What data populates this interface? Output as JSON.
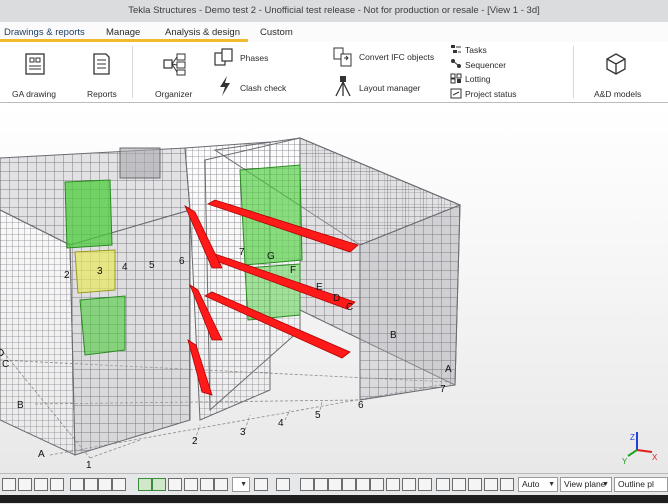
{
  "window": {
    "title": "Tekla Structures - Demo test 2  - Unofficial test release - Not for production or resale - [View 1 - 3d]"
  },
  "tabs": [
    {
      "label": "Drawings & reports",
      "active": true
    },
    {
      "label": "Manage",
      "active": false
    },
    {
      "label": "Analysis & design",
      "active": false
    },
    {
      "label": "Custom",
      "active": false
    }
  ],
  "ribbon": {
    "ga_drawing": {
      "label": "GA drawing",
      "icon": "ga-drawing-icon"
    },
    "reports": {
      "label": "Reports",
      "icon": "reports-icon"
    },
    "organizer": {
      "label": "Organizer",
      "icon": "organizer-icon"
    },
    "phases": {
      "label": "Phases",
      "icon": "phases-icon"
    },
    "clash_check": {
      "label": "Clash check",
      "icon": "lightning-icon"
    },
    "convert_ifc": {
      "label": "Convert IFC objects",
      "icon": "convert-ifc-icon"
    },
    "layout_manager": {
      "label": "Layout manager",
      "icon": "tripod-icon"
    },
    "tasks": {
      "label": "Tasks",
      "icon": "tasks-icon"
    },
    "sequencer": {
      "label": "Sequencer",
      "icon": "sequencer-icon"
    },
    "lotting": {
      "label": "Lotting",
      "icon": "lotting-icon"
    },
    "project_status": {
      "label": "Project status",
      "icon": "project-status-icon"
    },
    "ad_models": {
      "label": "A&D models",
      "icon": "cube-icon"
    }
  },
  "viewport": {
    "grid_labels": {
      "front_numbers": [
        "1",
        "2",
        "3",
        "4",
        "5",
        "6"
      ],
      "front_letters": [
        "A",
        "B",
        "C",
        "D"
      ],
      "right_numbers": [
        "6",
        "7"
      ],
      "right_letters": [
        "A",
        "B",
        "C",
        "D",
        "E",
        "F",
        "G",
        "7"
      ],
      "inner_labels": [
        "2",
        "3",
        "4",
        "5",
        "6"
      ]
    },
    "axis_labels": {
      "x": "X",
      "y": "Y",
      "z": "Z"
    },
    "colors": {
      "structure": "#8f8f94",
      "highlight_red": "#ff1a1a",
      "highlight_green": "#4ccc3c",
      "highlight_yellow": "#e8e860"
    }
  },
  "statusbar": {
    "auto_combo": "Auto",
    "view_plane_combo": "View plane",
    "outline_combo": "Outline pl"
  }
}
